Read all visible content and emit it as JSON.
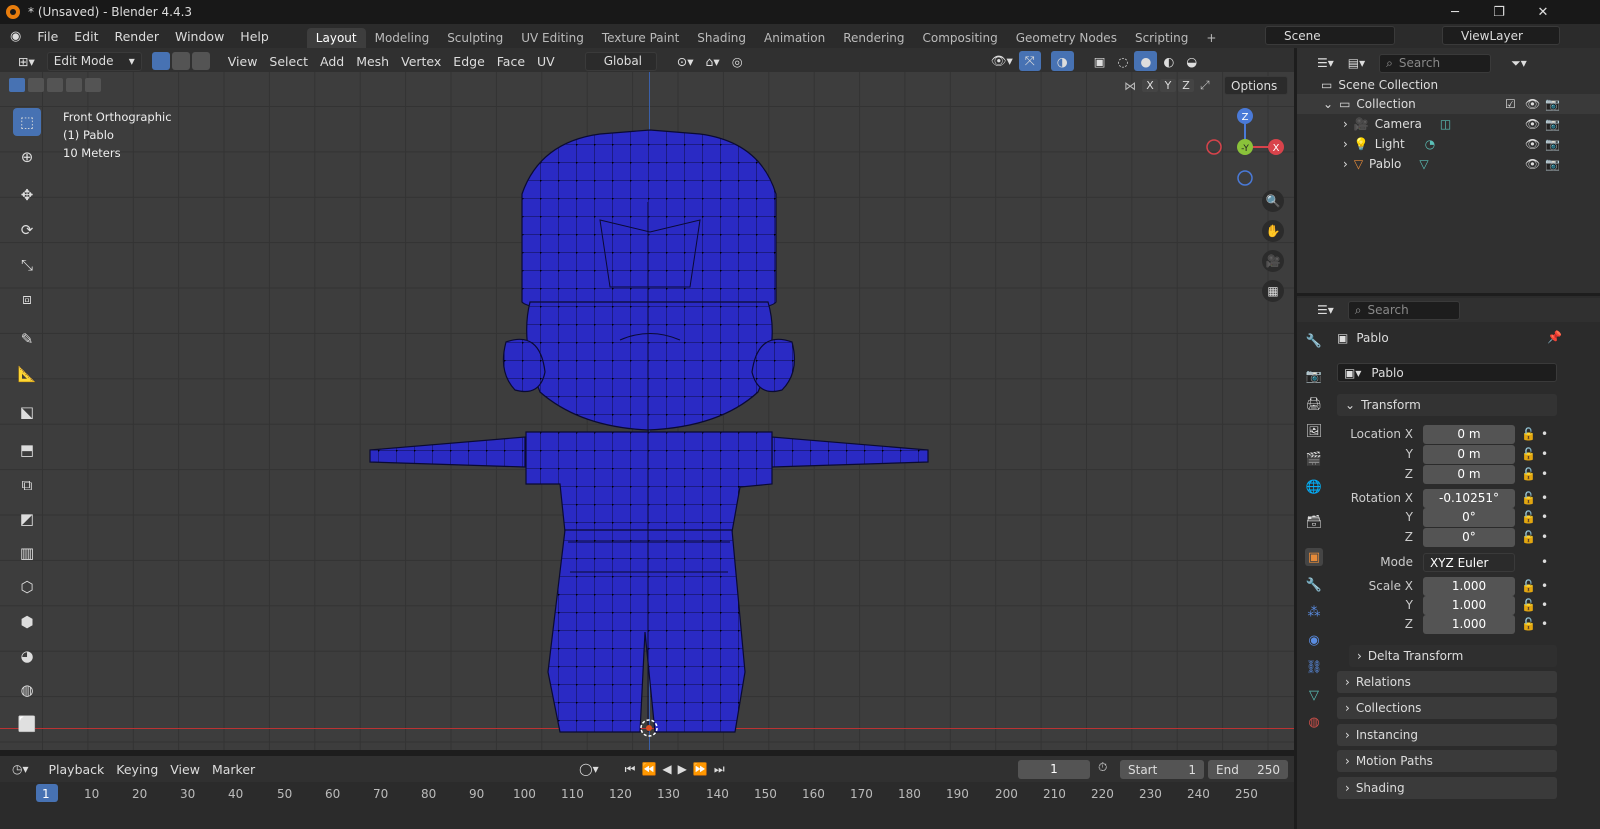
{
  "window": {
    "title": "* (Unsaved) - Blender 4.4.3",
    "min": "─",
    "max": "❐",
    "close": "✕"
  },
  "menu": [
    "File",
    "Edit",
    "Render",
    "Window",
    "Help"
  ],
  "workspaces": [
    "Layout",
    "Modeling",
    "Sculpting",
    "UV Editing",
    "Texture Paint",
    "Shading",
    "Animation",
    "Rendering",
    "Compositing",
    "Geometry Nodes",
    "Scripting"
  ],
  "add_ws": "+",
  "scene": "Scene",
  "viewlayer": "ViewLayer",
  "header": {
    "mode": "Edit Mode",
    "menus": [
      "View",
      "Select",
      "Add",
      "Mesh",
      "Vertex",
      "Edge",
      "Face",
      "UV"
    ],
    "orientation": "Global",
    "options": "Options",
    "axes": [
      "X",
      "Y",
      "Z"
    ]
  },
  "overlay_text": {
    "view": "Front Orthographic",
    "object": "(1) Pablo",
    "scale": "10 Meters"
  },
  "gizmo": {
    "z": "Z",
    "y": "-Y",
    "x": "X"
  },
  "outliner": {
    "search": "Search",
    "root": "Scene Collection",
    "collection": "Collection",
    "items": [
      "Camera",
      "Light",
      "Pablo"
    ]
  },
  "props": {
    "search": "Search",
    "object": "Pablo",
    "mesh": "Pablo",
    "transform": "Transform",
    "loc": {
      "lx": "Location X",
      "y": "Y",
      "z": "Z",
      "vx": "0 m",
      "vy": "0 m",
      "vz": "0 m"
    },
    "rot": {
      "lx": "Rotation X",
      "y": "Y",
      "z": "Z",
      "vx": "-0.10251°",
      "vy": "0°",
      "vz": "0°"
    },
    "mode_label": "Mode",
    "mode": "XYZ Euler",
    "scale": {
      "lx": "Scale X",
      "y": "Y",
      "z": "Z",
      "vx": "1.000",
      "vy": "1.000",
      "vz": "1.000"
    },
    "delta": "Delta Transform",
    "panels": [
      "Relations",
      "Collections",
      "Instancing",
      "Motion Paths",
      "Shading"
    ]
  },
  "timeline": {
    "menus": [
      "Playback",
      "Keying",
      "View",
      "Marker"
    ],
    "frame": "1",
    "start_label": "Start",
    "start": "1",
    "end_label": "End",
    "end": "250",
    "ticks": [
      "1",
      "10",
      "20",
      "30",
      "40",
      "50",
      "60",
      "70",
      "80",
      "90",
      "100",
      "110",
      "120",
      "130",
      "140",
      "150",
      "160",
      "170",
      "180",
      "190",
      "200",
      "210",
      "220",
      "230",
      "240",
      "250"
    ]
  }
}
